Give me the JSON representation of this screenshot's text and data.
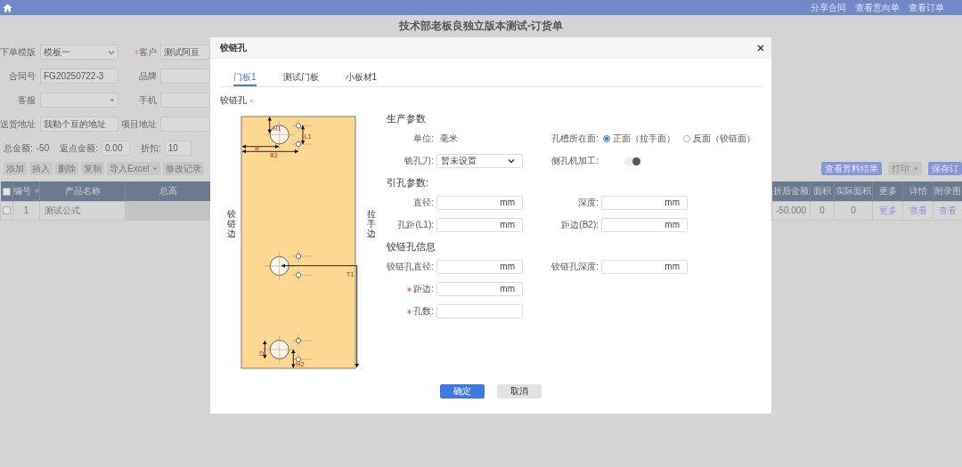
{
  "top_bar": {
    "links": [
      "分享合同",
      "查看意向单",
      "查看订单"
    ]
  },
  "page_title": "技术部老板良独立版本测试-订货单",
  "order_form": [
    {
      "fields": [
        {
          "label": "下单模版",
          "kind": "select",
          "value": "模板一"
        },
        {
          "label": "客户",
          "required": true,
          "kind": "input",
          "value": "测试阿豆"
        }
      ]
    },
    {
      "fields": [
        {
          "label": "合同号",
          "kind": "input",
          "value": "FG20250722-3"
        },
        {
          "label": "品牌",
          "kind": "input"
        }
      ]
    },
    {
      "fields": [
        {
          "label": "客服",
          "kind": "combo"
        },
        {
          "label": "手机",
          "kind": "input"
        }
      ]
    },
    {
      "fields": [
        {
          "label": "送货地址",
          "kind": "input",
          "value": "我勒个豆的地址"
        },
        {
          "label": "项目地址",
          "kind": "input"
        }
      ]
    }
  ],
  "totals": [
    {
      "label": "总金额:",
      "kind": "text",
      "value": "-50"
    },
    {
      "label": "返点金额:",
      "kind": "input",
      "value": "0.00"
    },
    {
      "label": "折扣:",
      "kind": "input",
      "value": "10"
    }
  ],
  "toolbar": [
    {
      "label": "添加"
    },
    {
      "label": "插入"
    },
    {
      "label": "删除"
    },
    {
      "label": "复制"
    },
    {
      "label": "导入Excel",
      "dropdown": true
    },
    {
      "label": "修改记录"
    }
  ],
  "actions": [
    {
      "label": "查看算料结果",
      "kind": "primary"
    },
    {
      "label": "打印",
      "kind": "secondary",
      "dropdown": true
    },
    {
      "label": "保存订",
      "kind": "primary"
    }
  ],
  "table_left": {
    "all_checked": false,
    "columns": [
      {
        "label": "编号",
        "required": true
      },
      {
        "label": "产品名称"
      },
      {
        "label": "总高"
      }
    ],
    "rows": [
      {
        "checked": false,
        "cells": [
          "1",
          "测试公式"
        ]
      }
    ]
  },
  "table_right": {
    "columns": [
      "折后金额",
      "面积",
      "实际面积",
      "更多",
      "详情",
      "附录图"
    ],
    "rows": [
      {
        "cells": [
          {
            "text": "-50.000"
          },
          {
            "text": "0"
          },
          {
            "text": "0"
          },
          {
            "text": "更多",
            "kind": "link"
          },
          {
            "text": "查看",
            "kind": "link"
          },
          {
            "text": "查看",
            "kind": "link"
          }
        ]
      }
    ]
  },
  "dialog": {
    "title": "铰链孔",
    "tabs": [
      {
        "label": "门板1",
        "selected": true
      },
      {
        "label": "测试门板",
        "selected": false
      },
      {
        "label": "小板材1",
        "selected": false
      }
    ],
    "caption": "铰链孔",
    "drawing": {
      "side_labels": [
        "铰链边",
        "拉手边"
      ],
      "dimension_labels": [
        "H1",
        "L1",
        "B",
        "B2",
        "T1",
        "D",
        "H2"
      ]
    },
    "form": [
      {
        "kind": "heading",
        "text": "生产参数"
      },
      {
        "kind": "row",
        "fields": [
          {
            "kind": "text",
            "label": "单位:",
            "value": "毫米"
          },
          {
            "kind": "radio",
            "label": "孔槽所在面:",
            "options": [
              {
                "label": "正面（拉手面）",
                "selected": true
              },
              {
                "label": "反面（铰链面）",
                "selected": false
              }
            ]
          }
        ]
      },
      {
        "kind": "row",
        "fields": [
          {
            "kind": "select",
            "label": "铣孔刀:",
            "value": "暂未设置"
          },
          {
            "kind": "toggle",
            "label": "侧孔机加工:",
            "on": true
          }
        ]
      },
      {
        "kind": "heading",
        "text": "引孔参数:"
      },
      {
        "kind": "row",
        "fields": [
          {
            "kind": "input",
            "label": "直径:",
            "unit": "mm"
          },
          {
            "kind": "input",
            "label": "深度:",
            "unit": "mm"
          }
        ]
      },
      {
        "kind": "row",
        "fields": [
          {
            "kind": "input",
            "label": "孔距(L1):",
            "unit": "mm"
          },
          {
            "kind": "input",
            "label": "距边(B2):",
            "unit": "mm"
          }
        ]
      },
      {
        "kind": "heading",
        "text": "铰链孔信息"
      },
      {
        "kind": "row",
        "fields": [
          {
            "kind": "input",
            "label": "铰链孔直径:",
            "unit": "mm"
          },
          {
            "kind": "input",
            "label": "铰链孔深度:",
            "unit": "mm"
          }
        ]
      },
      {
        "kind": "row",
        "fields": [
          {
            "kind": "input",
            "label": "距边:",
            "required": true,
            "unit": "mm"
          }
        ]
      },
      {
        "kind": "row",
        "fields": [
          {
            "kind": "input",
            "label": "孔数:",
            "required": true
          }
        ]
      }
    ],
    "buttons": [
      {
        "label": "确定",
        "kind": "primary"
      },
      {
        "label": "取消",
        "kind": "secondary"
      }
    ]
  }
}
